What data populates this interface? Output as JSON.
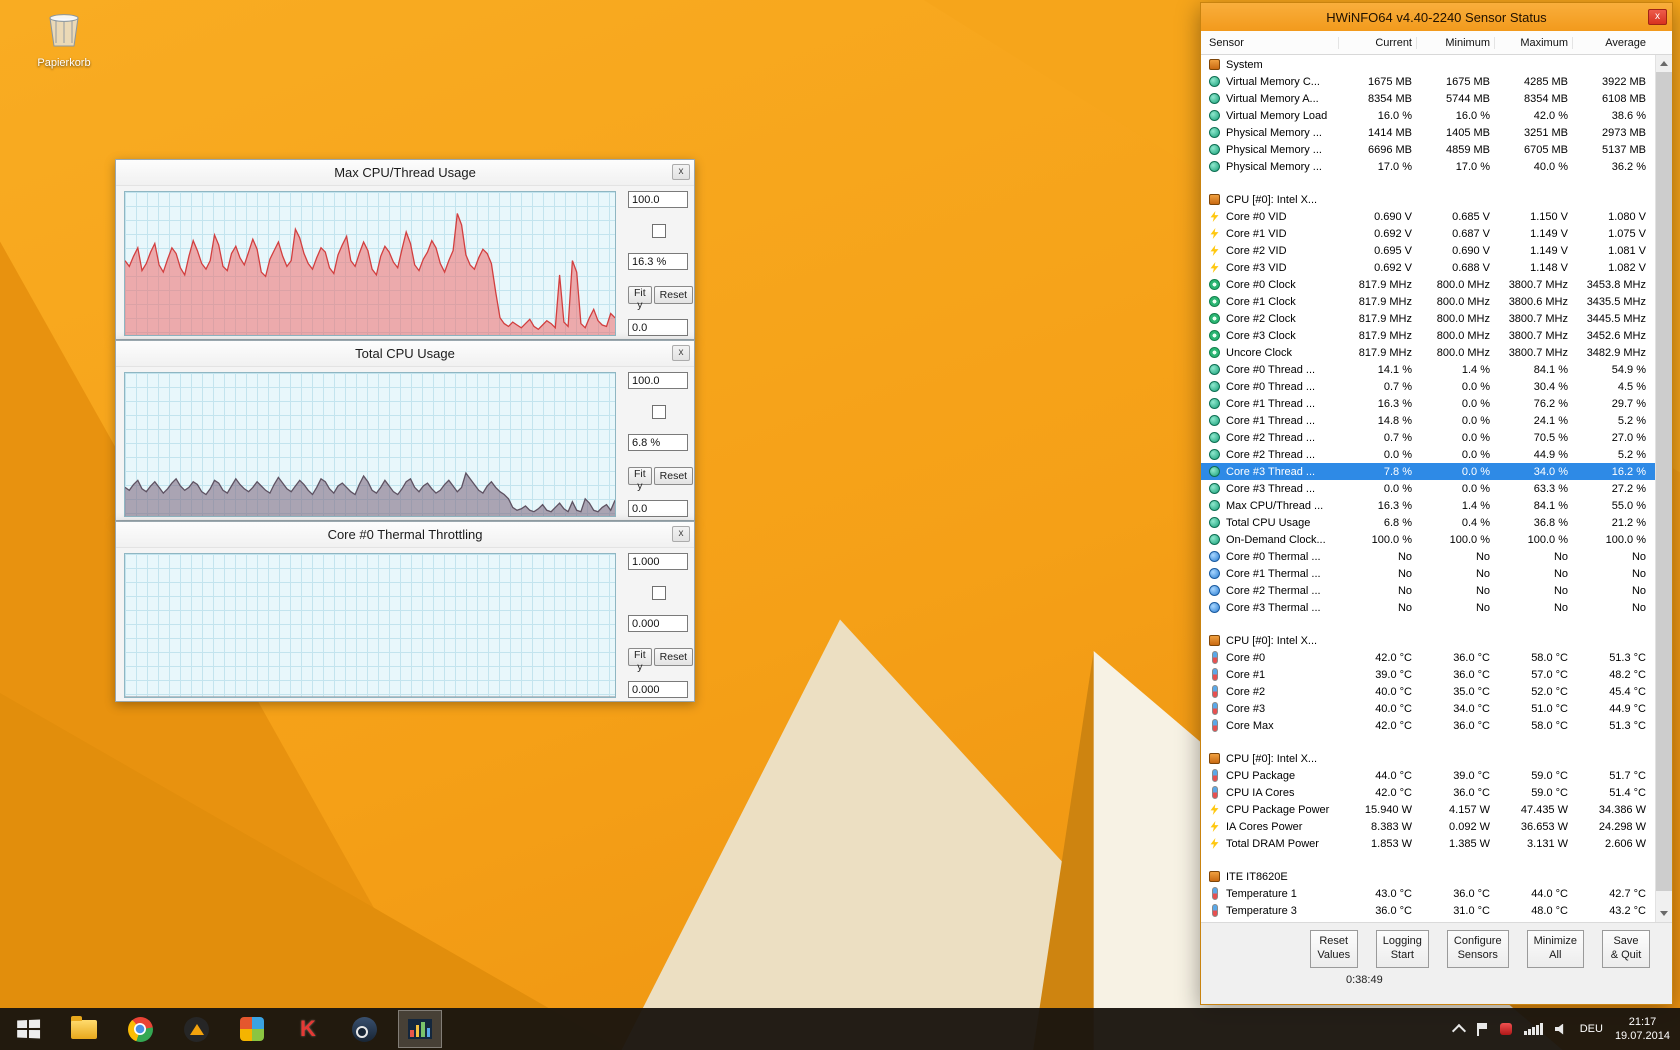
{
  "desktop": {
    "recycle_bin_label": "Papierkorb"
  },
  "taskbar": {
    "language": "DEU",
    "time": "21:17",
    "date": "19.07.2014",
    "kaspersky_glyph": "K"
  },
  "graphs": [
    {
      "title": "Max CPU/Thread Usage",
      "close_label": "x",
      "ymax_label": "100.0",
      "current_label": "16.3 %",
      "ymin_label": "0.0",
      "fit_label": "Fit y",
      "reset_label": "Reset",
      "ymax": 100,
      "stroke": "#D23F3F",
      "fill": "rgba(238,108,108,0.55)",
      "series": [
        52,
        48,
        55,
        61,
        45,
        50,
        58,
        64,
        49,
        44,
        53,
        61,
        57,
        47,
        42,
        55,
        66,
        59,
        50,
        46,
        52,
        70,
        63,
        48,
        45,
        57,
        62,
        54,
        49,
        58,
        67,
        60,
        44,
        41,
        53,
        59,
        65,
        55,
        48,
        52,
        74,
        68,
        57,
        50,
        46,
        54,
        61,
        58,
        47,
        43,
        56,
        63,
        69,
        52,
        48,
        57,
        65,
        59,
        46,
        42,
        55,
        62,
        58,
        51,
        47,
        60,
        72,
        64,
        49,
        45,
        53,
        58,
        66,
        61,
        50,
        44,
        52,
        59,
        85,
        77,
        56,
        49,
        46,
        54,
        60,
        57,
        50,
        30,
        12,
        8,
        6,
        9,
        7,
        5,
        8,
        11,
        6,
        4,
        7,
        10,
        8,
        5,
        42,
        9,
        6,
        52,
        44,
        8,
        5,
        12,
        18,
        10,
        7,
        6,
        15,
        12
      ]
    },
    {
      "title": "Total CPU Usage",
      "close_label": "x",
      "ymax_label": "100.0",
      "current_label": "6.8 %",
      "ymin_label": "0.0",
      "fit_label": "Fit y",
      "reset_label": "Reset",
      "ymax": 100,
      "stroke": "#5E5262",
      "fill": "rgba(128,108,132,0.6)",
      "series": [
        20,
        18,
        22,
        25,
        19,
        17,
        21,
        24,
        20,
        16,
        19,
        23,
        26,
        21,
        18,
        20,
        24,
        22,
        17,
        15,
        19,
        25,
        23,
        18,
        16,
        21,
        26,
        22,
        19,
        17,
        20,
        24,
        21,
        18,
        16,
        22,
        27,
        23,
        19,
        17,
        21,
        25,
        22,
        18,
        15,
        20,
        26,
        24,
        19,
        16,
        21,
        23,
        20,
        17,
        15,
        22,
        28,
        24,
        18,
        16,
        20,
        25,
        21,
        17,
        15,
        19,
        24,
        26,
        20,
        17,
        21,
        23,
        19,
        16,
        18,
        22,
        25,
        21,
        17,
        20,
        30,
        26,
        22,
        18,
        16,
        21,
        24,
        20,
        17,
        15,
        12,
        6,
        4,
        5,
        7,
        4,
        3,
        5,
        8,
        4,
        3,
        6,
        9,
        5,
        3,
        10,
        4,
        3,
        12,
        9,
        4,
        3,
        6,
        8,
        4,
        11
      ]
    },
    {
      "title": "Core #0 Thermal Throttling",
      "close_label": "x",
      "ymax_label": "1.000",
      "current_label": "0.000",
      "ymin_label": "0.000",
      "fit_label": "Fit y",
      "reset_label": "Reset",
      "ymax": 1,
      "stroke": "#9AA0A6",
      "fill": "transparent",
      "series": [
        0,
        0
      ]
    }
  ],
  "hwinfo": {
    "title": "HWiNFO64 v4.40-2240 Sensor Status",
    "close_label": "x",
    "columns": [
      "Sensor",
      "Current",
      "Minimum",
      "Maximum",
      "Average"
    ],
    "timer": "0:38:49",
    "buttons": [
      {
        "l1": "Reset",
        "l2": "Values"
      },
      {
        "l1": "Logging",
        "l2": "Start"
      },
      {
        "l1": "Configure",
        "l2": "Sensors"
      },
      {
        "l1": "Minimize",
        "l2": "All"
      },
      {
        "l1": "Save",
        "l2": "& Quit"
      }
    ],
    "rows": [
      {
        "g": 1,
        "icon": "chip",
        "label": "System"
      },
      {
        "icon": "gauge",
        "label": "Virtual Memory C...",
        "v": [
          "1675 MB",
          "1675 MB",
          "4285 MB",
          "3922 MB"
        ]
      },
      {
        "icon": "gauge",
        "label": "Virtual Memory A...",
        "v": [
          "8354 MB",
          "5744 MB",
          "8354 MB",
          "6108 MB"
        ]
      },
      {
        "icon": "gauge",
        "label": "Virtual Memory Load",
        "v": [
          "16.0 %",
          "16.0 %",
          "42.0 %",
          "38.6 %"
        ]
      },
      {
        "icon": "gauge",
        "label": "Physical Memory ...",
        "v": [
          "1414 MB",
          "1405 MB",
          "3251 MB",
          "2973 MB"
        ]
      },
      {
        "icon": "gauge",
        "label": "Physical Memory ...",
        "v": [
          "6696 MB",
          "4859 MB",
          "6705 MB",
          "5137 MB"
        ]
      },
      {
        "icon": "gauge",
        "label": "Physical Memory ...",
        "v": [
          "17.0 %",
          "17.0 %",
          "40.0 %",
          "36.2 %"
        ]
      },
      {
        "sp": 1
      },
      {
        "g": 1,
        "icon": "chip",
        "label": "CPU [#0]: Intel X..."
      },
      {
        "icon": "bolt",
        "label": "Core #0 VID",
        "v": [
          "0.690 V",
          "0.685 V",
          "1.150 V",
          "1.080 V"
        ]
      },
      {
        "icon": "bolt",
        "label": "Core #1 VID",
        "v": [
          "0.692 V",
          "0.687 V",
          "1.149 V",
          "1.075 V"
        ]
      },
      {
        "icon": "bolt",
        "label": "Core #2 VID",
        "v": [
          "0.695 V",
          "0.690 V",
          "1.149 V",
          "1.081 V"
        ]
      },
      {
        "icon": "bolt",
        "label": "Core #3 VID",
        "v": [
          "0.692 V",
          "0.688 V",
          "1.148 V",
          "1.082 V"
        ]
      },
      {
        "icon": "clock",
        "label": "Core #0 Clock",
        "v": [
          "817.9 MHz",
          "800.0 MHz",
          "3800.7 MHz",
          "3453.8 MHz"
        ]
      },
      {
        "icon": "clock",
        "label": "Core #1 Clock",
        "v": [
          "817.9 MHz",
          "800.0 MHz",
          "3800.6 MHz",
          "3435.5 MHz"
        ]
      },
      {
        "icon": "clock",
        "label": "Core #2 Clock",
        "v": [
          "817.9 MHz",
          "800.0 MHz",
          "3800.7 MHz",
          "3445.5 MHz"
        ]
      },
      {
        "icon": "clock",
        "label": "Core #3 Clock",
        "v": [
          "817.9 MHz",
          "800.0 MHz",
          "3800.7 MHz",
          "3452.6 MHz"
        ]
      },
      {
        "icon": "clock",
        "label": "Uncore Clock",
        "v": [
          "817.9 MHz",
          "800.0 MHz",
          "3800.7 MHz",
          "3482.9 MHz"
        ]
      },
      {
        "icon": "gauge",
        "label": "Core #0 Thread ...",
        "v": [
          "14.1 %",
          "1.4 %",
          "84.1 %",
          "54.9 %"
        ]
      },
      {
        "icon": "gauge",
        "label": "Core #0 Thread ...",
        "v": [
          "0.7 %",
          "0.0 %",
          "30.4 %",
          "4.5 %"
        ]
      },
      {
        "icon": "gauge",
        "label": "Core #1 Thread ...",
        "v": [
          "16.3 %",
          "0.0 %",
          "76.2 %",
          "29.7 %"
        ]
      },
      {
        "icon": "gauge",
        "label": "Core #1 Thread ...",
        "v": [
          "14.8 %",
          "0.0 %",
          "24.1 %",
          "5.2 %"
        ]
      },
      {
        "icon": "gauge",
        "label": "Core #2 Thread ...",
        "v": [
          "0.7 %",
          "0.0 %",
          "70.5 %",
          "27.0 %"
        ]
      },
      {
        "icon": "gauge",
        "label": "Core #2 Thread ...",
        "v": [
          "0.0 %",
          "0.0 %",
          "44.9 %",
          "5.2 %"
        ]
      },
      {
        "sel": 1,
        "icon": "gauge",
        "label": "Core #3 Thread ...",
        "v": [
          "7.8 %",
          "0.0 %",
          "34.0 %",
          "16.2 %"
        ]
      },
      {
        "icon": "gauge",
        "label": "Core #3 Thread ...",
        "v": [
          "0.0 %",
          "0.0 %",
          "63.3 %",
          "27.2 %"
        ]
      },
      {
        "icon": "gauge",
        "label": "Max CPU/Thread ...",
        "v": [
          "16.3 %",
          "1.4 %",
          "84.1 %",
          "55.0 %"
        ]
      },
      {
        "icon": "gauge",
        "label": "Total CPU Usage",
        "v": [
          "6.8 %",
          "0.4 %",
          "36.8 %",
          "21.2 %"
        ]
      },
      {
        "icon": "gauge",
        "label": "On-Demand Clock...",
        "v": [
          "100.0 %",
          "100.0 %",
          "100.0 %",
          "100.0 %"
        ]
      },
      {
        "icon": "blue",
        "label": "Core #0 Thermal ...",
        "v": [
          "No",
          "No",
          "No",
          "No"
        ]
      },
      {
        "icon": "blue",
        "label": "Core #1 Thermal ...",
        "v": [
          "No",
          "No",
          "No",
          "No"
        ]
      },
      {
        "icon": "blue",
        "label": "Core #2 Thermal ...",
        "v": [
          "No",
          "No",
          "No",
          "No"
        ]
      },
      {
        "icon": "blue",
        "label": "Core #3 Thermal ...",
        "v": [
          "No",
          "No",
          "No",
          "No"
        ]
      },
      {
        "sp": 1
      },
      {
        "g": 1,
        "icon": "chip",
        "label": "CPU [#0]: Intel X..."
      },
      {
        "icon": "thermo",
        "label": "Core #0",
        "v": [
          "42.0 °C",
          "36.0 °C",
          "58.0 °C",
          "51.3 °C"
        ]
      },
      {
        "icon": "thermo",
        "label": "Core #1",
        "v": [
          "39.0 °C",
          "36.0 °C",
          "57.0 °C",
          "48.2 °C"
        ]
      },
      {
        "icon": "thermo",
        "label": "Core #2",
        "v": [
          "40.0 °C",
          "35.0 °C",
          "52.0 °C",
          "45.4 °C"
        ]
      },
      {
        "icon": "thermo",
        "label": "Core #3",
        "v": [
          "40.0 °C",
          "34.0 °C",
          "51.0 °C",
          "44.9 °C"
        ]
      },
      {
        "icon": "thermo",
        "label": "Core Max",
        "v": [
          "42.0 °C",
          "36.0 °C",
          "58.0 °C",
          "51.3 °C"
        ]
      },
      {
        "sp": 1
      },
      {
        "g": 1,
        "icon": "chip",
        "label": "CPU [#0]: Intel X..."
      },
      {
        "icon": "thermo",
        "label": "CPU Package",
        "v": [
          "44.0 °C",
          "39.0 °C",
          "59.0 °C",
          "51.7 °C"
        ]
      },
      {
        "icon": "thermo",
        "label": "CPU IA Cores",
        "v": [
          "42.0 °C",
          "36.0 °C",
          "59.0 °C",
          "51.4 °C"
        ]
      },
      {
        "icon": "bolt",
        "label": "CPU Package Power",
        "v": [
          "15.940 W",
          "4.157 W",
          "47.435 W",
          "34.386 W"
        ]
      },
      {
        "icon": "bolt",
        "label": "IA Cores Power",
        "v": [
          "8.383 W",
          "0.092 W",
          "36.653 W",
          "24.298 W"
        ]
      },
      {
        "icon": "bolt",
        "label": "Total DRAM Power",
        "v": [
          "1.853 W",
          "1.385 W",
          "3.131 W",
          "2.606 W"
        ]
      },
      {
        "sp": 1
      },
      {
        "g": 1,
        "icon": "chip",
        "label": "ITE IT8620E"
      },
      {
        "icon": "thermo",
        "label": "Temperature 1",
        "v": [
          "43.0 °C",
          "36.0 °C",
          "44.0 °C",
          "42.7 °C"
        ]
      },
      {
        "icon": "thermo",
        "label": "Temperature 3",
        "v": [
          "36.0 °C",
          "31.0 °C",
          "48.0 °C",
          "43.2 °C"
        ]
      }
    ]
  }
}
